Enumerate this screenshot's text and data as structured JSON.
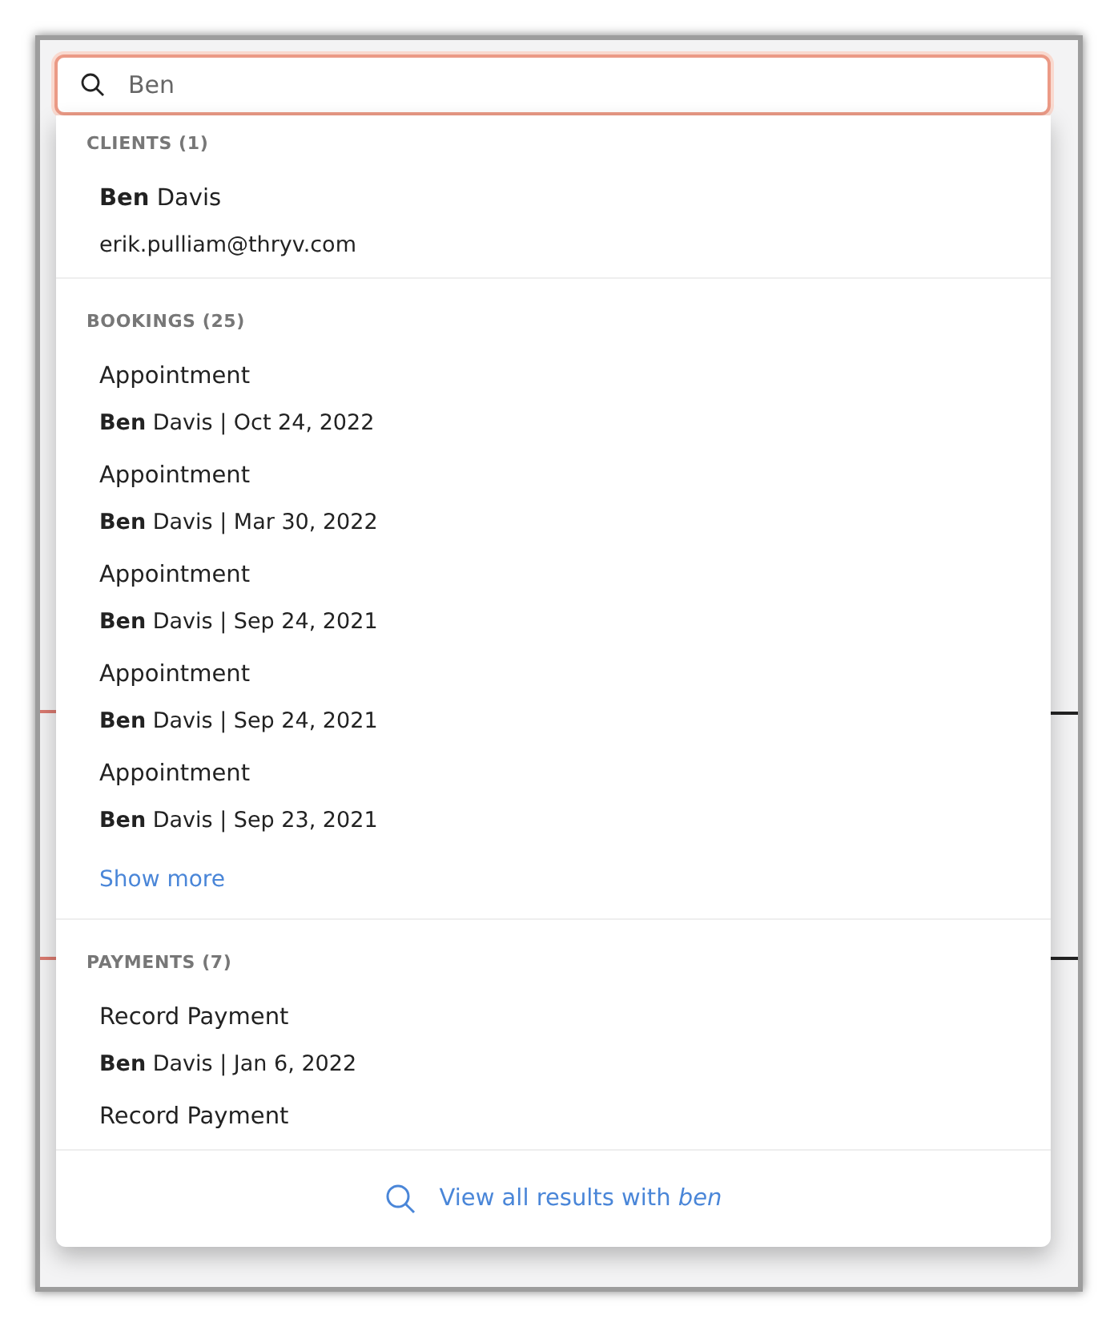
{
  "search": {
    "value": "Ben"
  },
  "sections": [
    {
      "title": "CLIENTS (1)",
      "items": [
        {
          "title": "**Ben** Davis",
          "subtitle": "erik.pulliam@thryv.com"
        }
      ]
    },
    {
      "title": "BOOKINGS (25)",
      "items": [
        {
          "title": "Appointment",
          "subtitle": "**Ben** Davis | Oct 24, 2022"
        },
        {
          "title": "Appointment",
          "subtitle": "**Ben** Davis | Mar 30, 2022"
        },
        {
          "title": "Appointment",
          "subtitle": "**Ben** Davis | Sep 24, 2021"
        },
        {
          "title": "Appointment",
          "subtitle": "**Ben** Davis | Sep 24, 2021"
        },
        {
          "title": "Appointment",
          "subtitle": "**Ben** Davis | Sep 23, 2021"
        }
      ],
      "more": "Show more"
    },
    {
      "title": "PAYMENTS (7)",
      "items": [
        {
          "title": "Record Payment",
          "subtitle": "**Ben** Davis | Jan 6, 2022"
        },
        {
          "title": "Record Payment"
        }
      ]
    }
  ],
  "footer": "View all results with *ben*"
}
